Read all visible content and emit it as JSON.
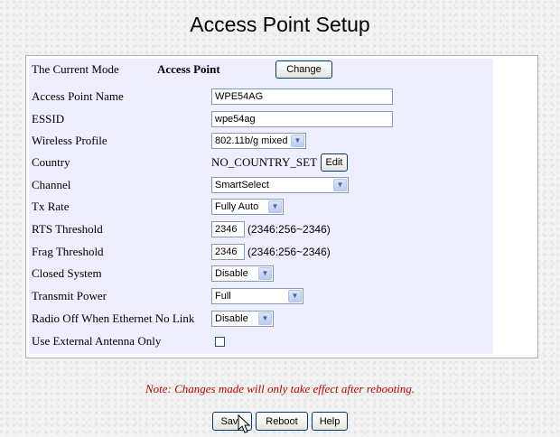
{
  "page": {
    "title": "Access Point Setup"
  },
  "mode": {
    "label": "The Current Mode",
    "value": "Access Point",
    "change_button": "Change"
  },
  "fields": {
    "ap_name": {
      "label": "Access Point Name",
      "value": "WPE54AG"
    },
    "essid": {
      "label": "ESSID",
      "value": "wpe54ag"
    },
    "wireless_profile": {
      "label": "Wireless Profile",
      "selected": "802.11b/g mixed"
    },
    "country": {
      "label": "Country",
      "value": "NO_COUNTRY_SET",
      "edit_button": "Edit"
    },
    "channel": {
      "label": "Channel",
      "selected": "SmartSelect"
    },
    "tx_rate": {
      "label": "Tx Rate",
      "selected": "Fully Auto"
    },
    "rts_threshold": {
      "label": "RTS Threshold",
      "value": "2346",
      "range": "(2346:256~2346)"
    },
    "frag_threshold": {
      "label": "Frag Threshold",
      "value": "2346",
      "range": "(2346:256~2346)"
    },
    "closed_system": {
      "label": "Closed System",
      "selected": "Disable"
    },
    "transmit_power": {
      "label": "Transmit Power",
      "selected": "Full"
    },
    "radio_off": {
      "label": "Radio Off When Ethernet No Link",
      "selected": "Disable"
    },
    "external_antenna": {
      "label": "Use External Antenna Only",
      "checked": false
    }
  },
  "note": "Note: Changes made will only take effect after rebooting.",
  "buttons": {
    "save": "Save",
    "reboot": "Reboot",
    "help": "Help"
  },
  "icons": {
    "dropdown": "chevron-down-icon",
    "cursor": "mouse-pointer-icon"
  },
  "colors": {
    "panel_bg": "#eeeeff",
    "note": "#c00000",
    "input_border": "#7f9db9"
  }
}
